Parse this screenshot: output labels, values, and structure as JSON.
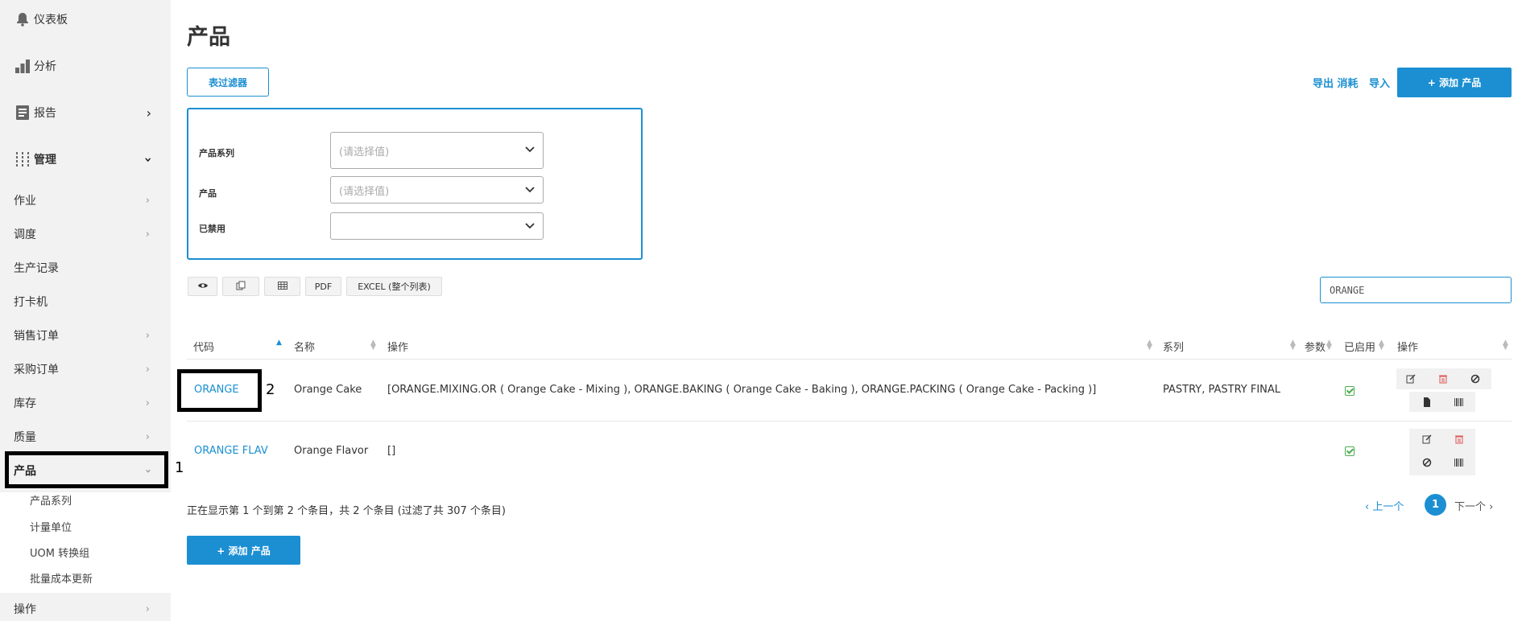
{
  "sidebar": {
    "top_items": [
      {
        "label": "仪表板",
        "icon": "bell-icon"
      },
      {
        "label": "分析",
        "icon": "bar-chart-icon"
      },
      {
        "label": "报告",
        "icon": "report-icon"
      },
      {
        "label": "管理",
        "icon": "sliders-icon"
      }
    ],
    "items": [
      {
        "label": "作业"
      },
      {
        "label": "调度"
      },
      {
        "label": "生产记录"
      },
      {
        "label": "打卡机"
      },
      {
        "label": "销售订单"
      },
      {
        "label": "采购订单"
      },
      {
        "label": "库存"
      },
      {
        "label": "质量"
      },
      {
        "label": "产品"
      }
    ],
    "sub_items": [
      {
        "label": "产品系列"
      },
      {
        "label": "计量单位"
      },
      {
        "label": "UOM 转换组"
      },
      {
        "label": "批量成本更新"
      }
    ],
    "bottom_item": {
      "label": "操作"
    }
  },
  "annotations": {
    "one": "1",
    "two": "2"
  },
  "main": {
    "title": "产品",
    "filter_button": "表过滤器",
    "export_link": "导出 消耗",
    "import_link": "导入",
    "add_button": "+ 添加 产品",
    "filters": [
      {
        "label": "产品系列",
        "placeholder": "(请选择值)"
      },
      {
        "label": "产品",
        "placeholder": "(请选择值)"
      },
      {
        "label": "已禁用",
        "placeholder": ""
      }
    ],
    "tools": {
      "pdf": "PDF",
      "excel": "EXCEL (整个列表)"
    },
    "search_value": "ORANGE",
    "table": {
      "headers": [
        "代码",
        "名称",
        "操作",
        "系列",
        "参数",
        "已启用",
        "操作"
      ],
      "rows": [
        {
          "code": "ORANGE",
          "name": "Orange Cake",
          "ops": "[ORANGE.MIXING.OR ( Orange Cake - Mixing ), ORANGE.BAKING ( Orange Cake - Baking ), ORANGE.PACKING ( Orange Cake - Packing )]",
          "series": "PASTRY, PASTRY FINAL",
          "enabled": true
        },
        {
          "code": "ORANGE FLAV",
          "name": "Orange Flavor",
          "ops": "[]",
          "series": "",
          "enabled": true
        }
      ]
    },
    "info": "正在显示第 1 个到第 2 个条目，共 2 个条目 (过滤了共 307 个条目)",
    "pager": {
      "prev": "上一个",
      "current": "1",
      "next": "下一个"
    },
    "bottom_add_button": "+ 添加 产品"
  },
  "colors": {
    "accent": "#1b8fd2",
    "sidebar_bg": "#f2f2f2",
    "enabled_green": "#4caf50",
    "delete_red": "#e05555"
  }
}
